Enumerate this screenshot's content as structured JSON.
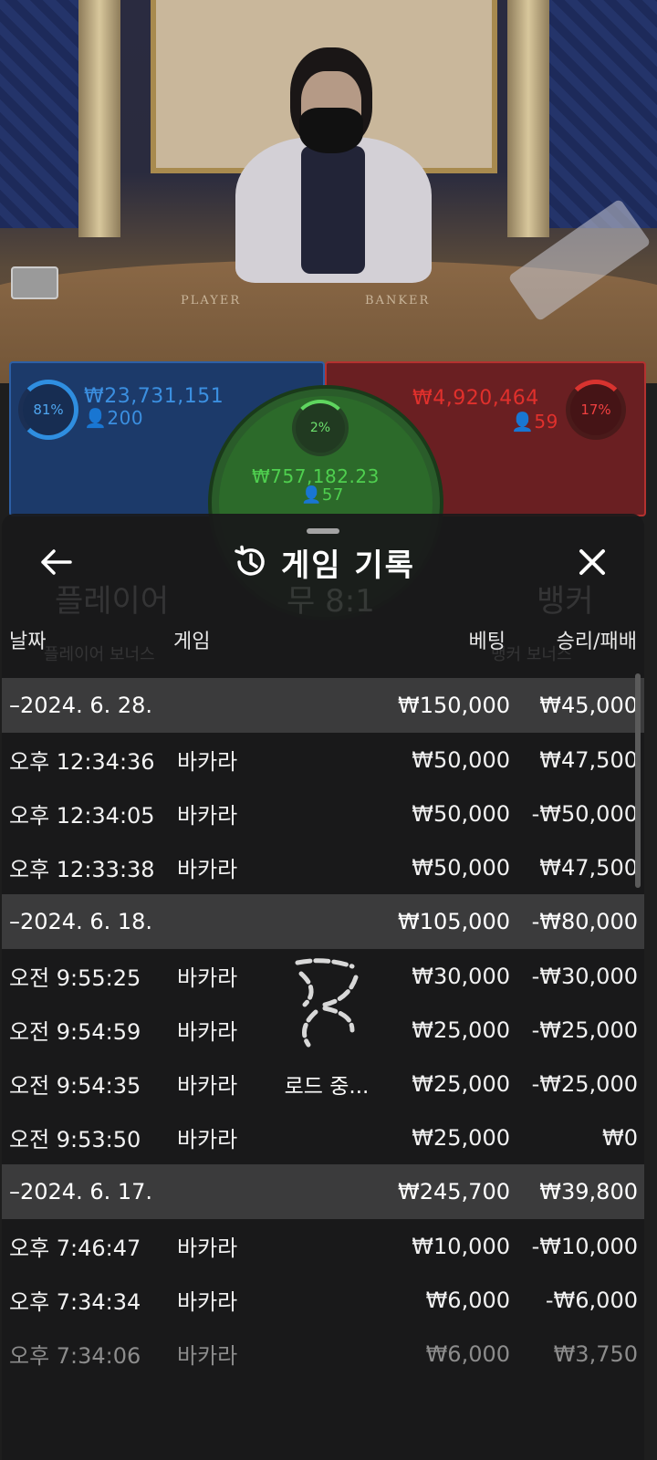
{
  "stream": {
    "table_words": [
      "PLAYER",
      "BANKER"
    ]
  },
  "bets": {
    "player": {
      "percent": "81%",
      "amount": "₩23,731,151",
      "players": "200",
      "color": "#2f8ee0"
    },
    "banker": {
      "percent": "17%",
      "amount": "₩4,920,464",
      "players": "59",
      "color": "#d8332f"
    },
    "tie": {
      "percent": "2%",
      "amount": "₩757,182.23",
      "players": "57",
      "color": "#4fcf4f"
    }
  },
  "modal": {
    "title": "게임 기록",
    "icons": {
      "back": "arrow-left-icon",
      "history": "history-clock-icon",
      "close": "close-icon"
    },
    "columns": {
      "date": "날짜",
      "game": "게임",
      "bet": "베팅",
      "result": "승리/패배"
    },
    "groups": [
      {
        "date": "–2024. 6. 28.",
        "bet_total": "₩150,000",
        "result_total": "₩45,000",
        "rows": [
          {
            "time": "오후 12:34:36",
            "game": "바카라",
            "bet": "₩50,000",
            "result": "₩47,500"
          },
          {
            "time": "오후 12:34:05",
            "game": "바카라",
            "bet": "₩50,000",
            "result": "-₩50,000"
          },
          {
            "time": "오후 12:33:38",
            "game": "바카라",
            "bet": "₩50,000",
            "result": "₩47,500"
          }
        ]
      },
      {
        "date": "–2024. 6. 18.",
        "bet_total": "₩105,000",
        "result_total": "-₩80,000",
        "rows": [
          {
            "time": "오전 9:55:25",
            "game": "바카라",
            "bet": "₩30,000",
            "result": "-₩30,000"
          },
          {
            "time": "오전 9:54:59",
            "game": "바카라",
            "bet": "₩25,000",
            "result": "-₩25,000"
          },
          {
            "time": "오전 9:54:35",
            "game": "바카라",
            "bet": "₩25,000",
            "result": "-₩25,000"
          },
          {
            "time": "오전 9:53:50",
            "game": "바카라",
            "bet": "₩25,000",
            "result": "₩0"
          }
        ]
      },
      {
        "date": "–2024. 6. 17.",
        "bet_total": "₩245,700",
        "result_total": "₩39,800",
        "rows": [
          {
            "time": "오후 7:46:47",
            "game": "바카라",
            "bet": "₩10,000",
            "result": "-₩10,000"
          },
          {
            "time": "오후 7:34:34",
            "game": "바카라",
            "bet": "₩6,000",
            "result": "-₩6,000"
          },
          {
            "time": "오후 7:34:06",
            "game": "바카라",
            "bet": "₩6,000",
            "result": "₩3,750"
          }
        ]
      }
    ],
    "loading_text": "로드 중..."
  },
  "background_ghost": {
    "player_label": "플레이어",
    "tie_label": "무 8:1",
    "banker_label": "뱅커",
    "player_bonus": "플레이어 보너스",
    "banker_bonus": "뱅커 보너스"
  }
}
